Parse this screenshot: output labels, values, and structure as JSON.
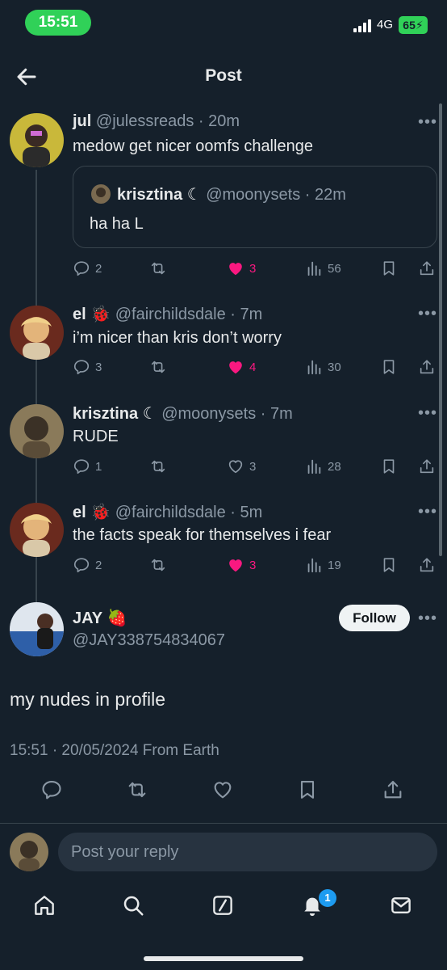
{
  "status_bar": {
    "time": "15:51",
    "network": "4G",
    "battery": "65"
  },
  "header": {
    "title": "Post"
  },
  "thread": [
    {
      "name": "jul",
      "handle": "@julessreads",
      "time": "20m",
      "text": "medow get nicer oomfs challenge",
      "quote": {
        "name": "krisztina",
        "moon": "☾",
        "handle": "@moonysets",
        "time": "22m",
        "text": "ha ha L"
      },
      "replies": "2",
      "likes": "3",
      "liked": true,
      "views": "56"
    },
    {
      "name": "el",
      "emoji": "🐞",
      "handle": "@fairchildsdale",
      "time": "7m",
      "text": "i’m nicer than kris don’t worry",
      "replies": "3",
      "likes": "4",
      "liked": true,
      "views": "30"
    },
    {
      "name": "krisztina",
      "moon": "☾",
      "handle": "@moonysets",
      "time": "7m",
      "text": "RUDE",
      "replies": "1",
      "likes": "3",
      "liked": false,
      "views": "28"
    },
    {
      "name": "el",
      "emoji": "🐞",
      "handle": "@fairchildsdale",
      "time": "5m",
      "text": "the facts speak for themselves i fear",
      "replies": "2",
      "likes": "3",
      "liked": true,
      "views": "19"
    }
  ],
  "main_tweet": {
    "name": "JAY",
    "emoji": "🍓",
    "handle": "@JAY338754834067",
    "follow_label": "Follow",
    "text": "my nudes in profile",
    "meta": "15:51 · 20/05/2024 From Earth"
  },
  "reply_bar": {
    "placeholder": "Post your reply"
  },
  "tabbar": {
    "notifications_badge": "1"
  },
  "colors": {
    "background": "#15202b",
    "like": "#f91880",
    "accent": "#1d9bf0",
    "status_green": "#30d158"
  }
}
